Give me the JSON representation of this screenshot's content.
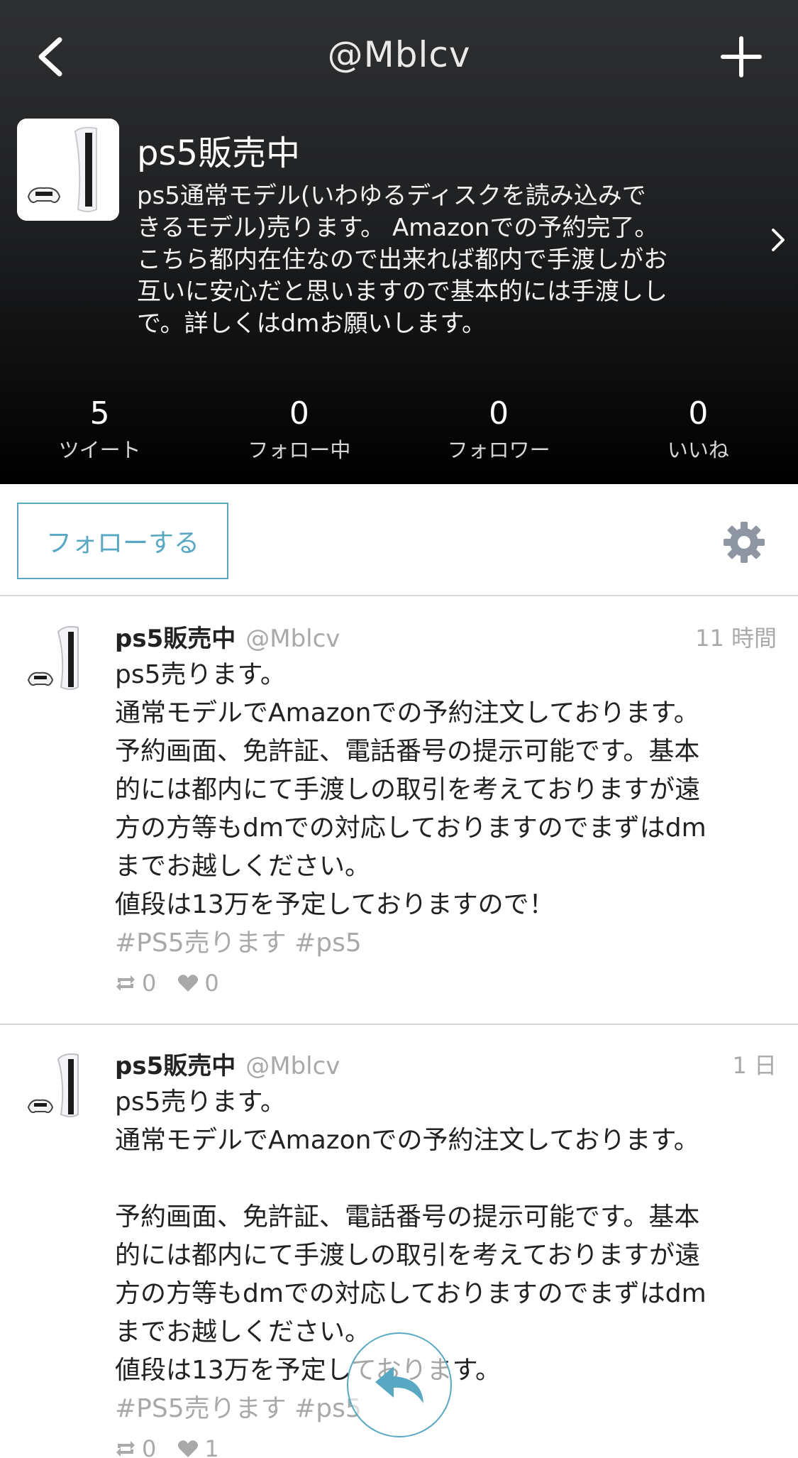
{
  "header": {
    "handle": "@Mblcv",
    "profile_name": "ps5販売中",
    "bio": "ps5通常モデル(いわゆるディスクを読み込みで\nきるモデル)売ります。 Amazonでの予約完了。\nこちら都内在住なので出来れば都内で手渡しがお\n互いに安心だと思いますので基本的には手渡しし\nで。詳しくはdmお願いします。"
  },
  "stats": [
    {
      "count": "5",
      "label": "ツイート"
    },
    {
      "count": "0",
      "label": "フォロー中"
    },
    {
      "count": "0",
      "label": "フォロワー"
    },
    {
      "count": "0",
      "label": "いいね"
    }
  ],
  "follow_label": "フォローする",
  "tweets": [
    {
      "name": "ps5販売中",
      "user": "@Mblcv",
      "time": "11 時間",
      "body": "ps5売ります。\n通常モデルでAmazonでの予約注文しております。\n予約画面、免許証、電話番号の提示可能です。基本\n的には都内にて手渡しの取引を考えておりますが遠\n方の方等もdmでの対応しておりますのでまずはdm\nまでお越しください。\n値段は13万を予定しておりますので！",
      "tags": "#PS5売ります #ps5",
      "retweets": "0",
      "likes": "0"
    },
    {
      "name": "ps5販売中",
      "user": "@Mblcv",
      "time": "1 日",
      "body": "ps5売ります。\n通常モデルでAmazonでの予約注文しております。\n\n予約画面、免許証、電話番号の提示可能です。基本\n的には都内にて手渡しの取引を考えておりますが遠\n方の方等もdmでの対応しておりますのでまずはdm\nまでお越しください。\n値段は13万を予定しております。",
      "tags": "#PS5売ります #ps5",
      "retweets": "0",
      "likes": "1"
    }
  ],
  "colors": {
    "accent": "#58a8c4",
    "muted": "#a9a9a9",
    "header_dark": "#1f2022"
  }
}
